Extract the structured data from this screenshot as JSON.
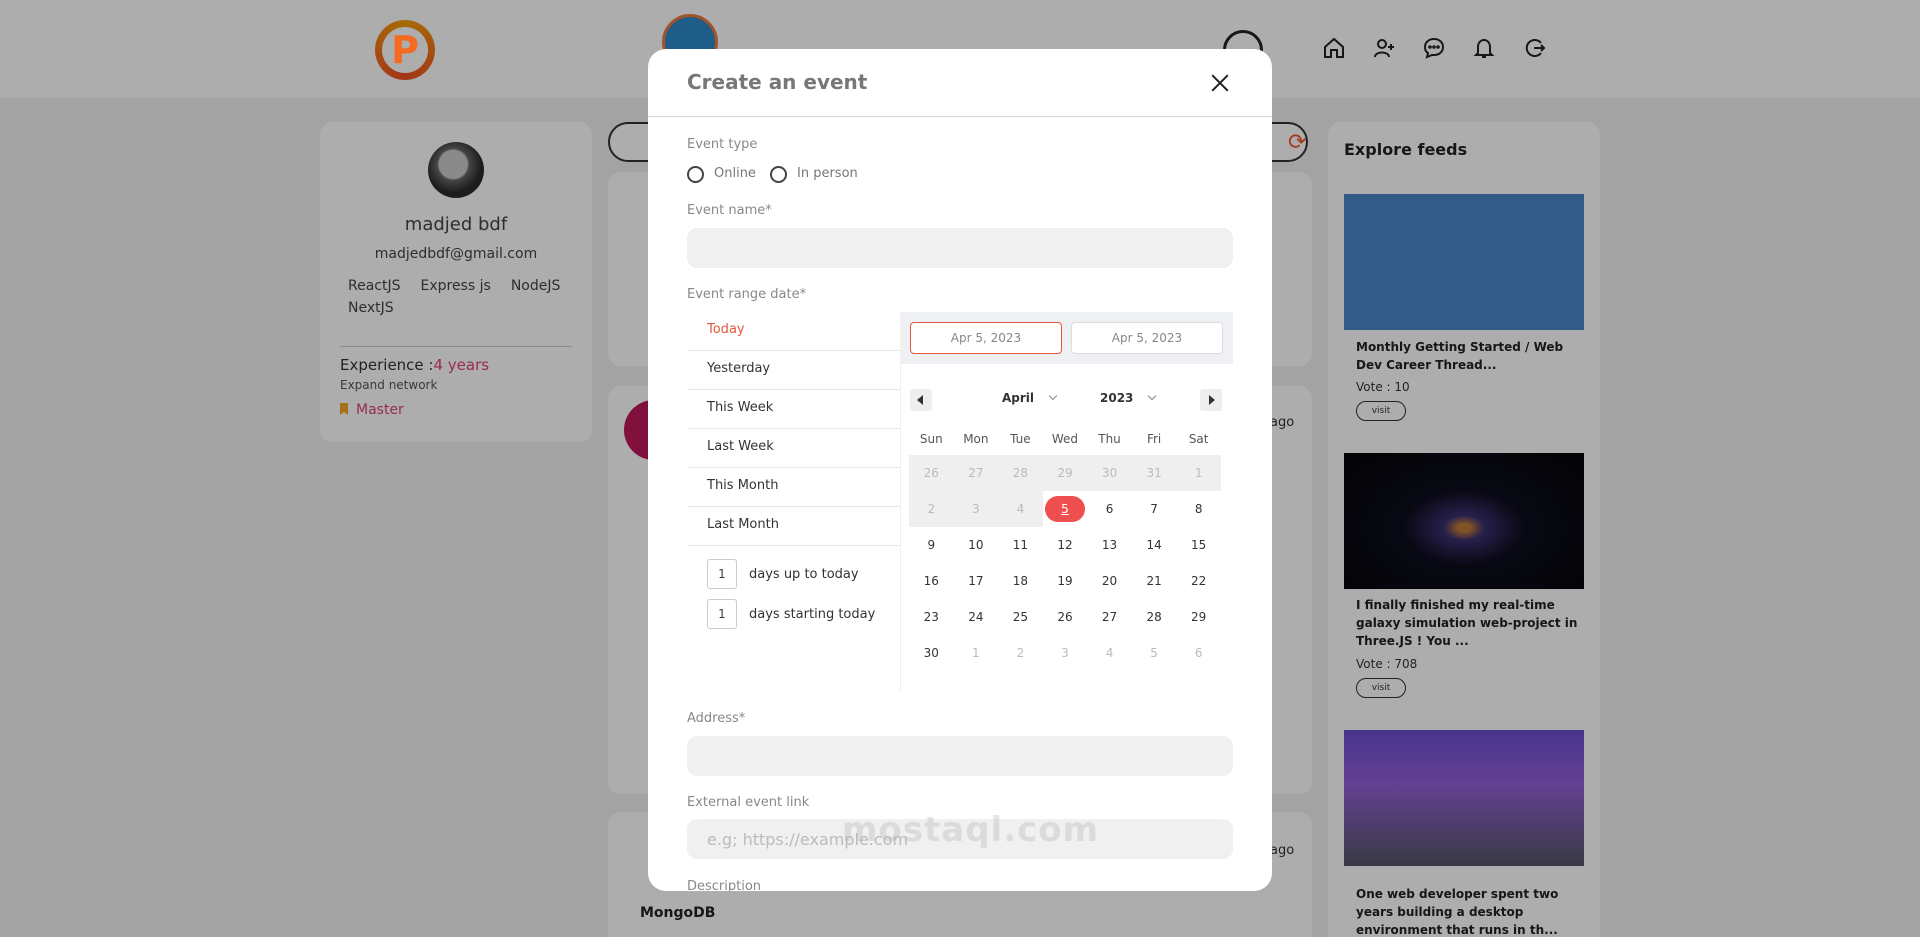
{
  "header": {
    "logo_letter": "P"
  },
  "profile": {
    "name": "madjed bdf",
    "email": "madjedbdf@gmail.com",
    "skills": [
      "ReactJS",
      "Express js",
      "NodeJS",
      "NextJS"
    ],
    "experience_label": "Experience :",
    "experience_value": "4 years",
    "expand_label": "Expand network",
    "level": "Master"
  },
  "feed": {
    "time_ago_1": "ago",
    "time_ago_2": "ago",
    "post_company": "MongoDB"
  },
  "explore": {
    "title": "Explore feeds",
    "items": [
      {
        "title": "Monthly Getting Started / Web Dev Career Thread...",
        "vote": "Vote : 10",
        "visit": "visit"
      },
      {
        "title": "I finally finished my real-time galaxy simulation web-project in Three.JS ! You ...",
        "vote": "Vote : 708",
        "visit": "visit"
      },
      {
        "title": "One web developer spent two years building a desktop environment that runs in th..."
      }
    ]
  },
  "modal": {
    "title": "Create an event",
    "event_type_label": "Event type",
    "type_options": [
      "Online",
      "In person"
    ],
    "event_name_label": "Event name*",
    "event_name_value": "",
    "date_range_label": "Event range date*",
    "ranges": [
      "Today",
      "Yesterday",
      "This Week",
      "Last Week",
      "This Month",
      "Last Month"
    ],
    "days_up_value": "1",
    "days_up_label": "days up to today",
    "days_start_value": "1",
    "days_start_label": "days starting today",
    "start_date": "Apr 5, 2023",
    "end_date": "Apr 5, 2023",
    "month": "April",
    "year": "2023",
    "weekdays": [
      "Sun",
      "Mon",
      "Tue",
      "Wed",
      "Thu",
      "Fri",
      "Sat"
    ],
    "weeks": [
      [
        "26",
        "27",
        "28",
        "29",
        "30",
        "31",
        "1"
      ],
      [
        "2",
        "3",
        "4",
        "5",
        "6",
        "7",
        "8"
      ],
      [
        "9",
        "10",
        "11",
        "12",
        "13",
        "14",
        "15"
      ],
      [
        "16",
        "17",
        "18",
        "19",
        "20",
        "21",
        "22"
      ],
      [
        "23",
        "24",
        "25",
        "26",
        "27",
        "28",
        "29"
      ],
      [
        "30",
        "1",
        "2",
        "3",
        "4",
        "5",
        "6"
      ]
    ],
    "selected_day": "5",
    "address_label": "Address*",
    "address_value": "",
    "external_link_label": "External event link",
    "external_link_placeholder": "e.g; https://example.com",
    "description_label": "Description"
  },
  "watermark": "mostaql.com"
}
